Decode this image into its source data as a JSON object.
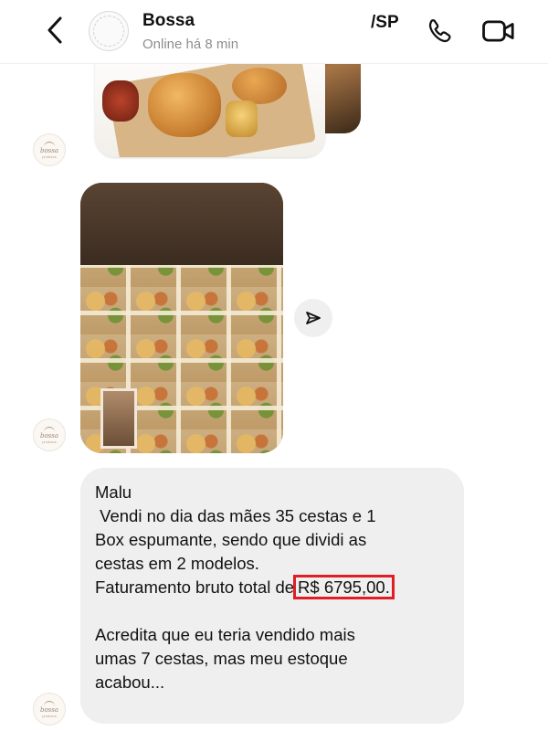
{
  "header": {
    "contact_name": "Bossa",
    "status": "Online há 8 min",
    "suffix_label": "/SP",
    "icons": {
      "back": "chevron-left-icon",
      "call": "phone-icon",
      "video": "video-camera-icon"
    }
  },
  "avatar": {
    "logo_text": "bossa",
    "logo_sub": "produtos"
  },
  "message": {
    "lines": [
      "Malu",
      " Vendi no dia das mães 35 cestas e 1",
      "Box espumante, sendo que dividi as",
      "cestas em 2 modelos.",
      "Faturamento bruto total de",
      "",
      "Acredita que eu teria vendido mais",
      "umas 7 cestas, mas meu estoque",
      "acabou..."
    ],
    "highlighted_value": "R$ 6795,00.",
    "highlight_color": "#e01e25"
  }
}
